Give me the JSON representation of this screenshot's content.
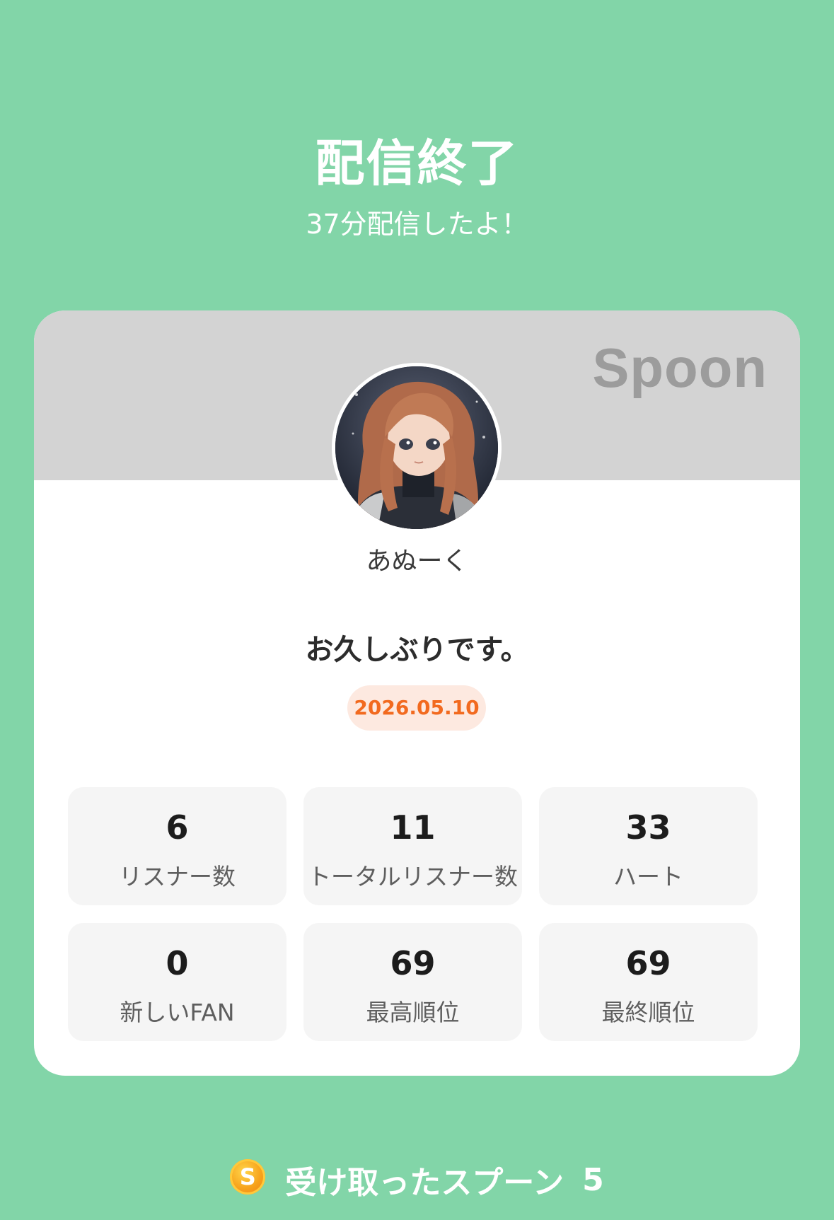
{
  "header": {
    "title": "配信終了",
    "subtitle": "37分配信したよ！"
  },
  "card": {
    "brand": "Spoon",
    "username": "あぬーく",
    "message": "お久しぶりです。",
    "date": "2026.05.10",
    "stats": [
      {
        "value": "6",
        "label": "リスナー数"
      },
      {
        "value": "11",
        "label": "トータルリスナー数"
      },
      {
        "value": "33",
        "label": "ハート"
      },
      {
        "value": "0",
        "label": "新しいFAN"
      },
      {
        "value": "69",
        "label": "最高順位"
      },
      {
        "value": "69",
        "label": "最終順位"
      }
    ]
  },
  "footer": {
    "coin_icon": "spoon-coin-icon",
    "coin_letter": "S",
    "received_label": "受け取ったスプーン",
    "received_count": "5"
  },
  "colors": {
    "background": "#82d5a8",
    "banner": "#d3d3d3",
    "date_text": "#f26a1f",
    "date_bg": "#fde9e0",
    "stat_bg": "#f5f5f5"
  }
}
